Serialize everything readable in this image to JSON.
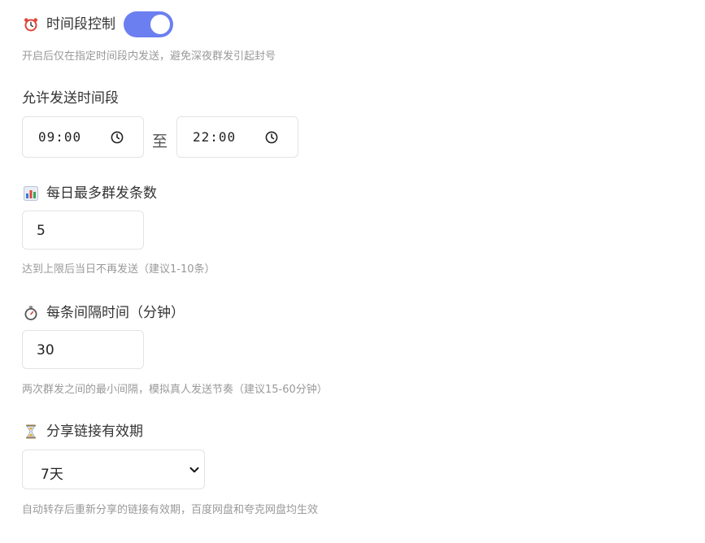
{
  "time_control": {
    "label": "时间段控制",
    "enabled": true,
    "hint": "开启后仅在指定时间段内发送，避免深夜群发引起封号"
  },
  "time_range": {
    "label": "允许发送时间段",
    "start": "09:00",
    "separator": "至",
    "end": "22:00"
  },
  "daily_limit": {
    "label": "每日最多群发条数",
    "value": "5",
    "hint": "达到上限后当日不再发送（建议1-10条）"
  },
  "interval": {
    "label": "每条间隔时间（分钟）",
    "value": "30",
    "hint": "两次群发之间的最小间隔，模拟真人发送节奏（建议15-60分钟）"
  },
  "link_validity": {
    "label": "分享链接有效期",
    "selected": "7天",
    "hint": "自动转存后重新分享的链接有效期，百度网盘和夸克网盘均生效"
  },
  "icons": {
    "time_control": "alarm-clock-icon",
    "daily_limit": "bar-chart-icon",
    "interval": "stopwatch-icon",
    "link_validity": "hourglass-icon",
    "time_picker": "clock-icon",
    "select": "chevron-down-icon"
  },
  "colors": {
    "toggle_on": "#6b7ff0",
    "hint_text": "#999999",
    "border": "#e3e3e3"
  }
}
